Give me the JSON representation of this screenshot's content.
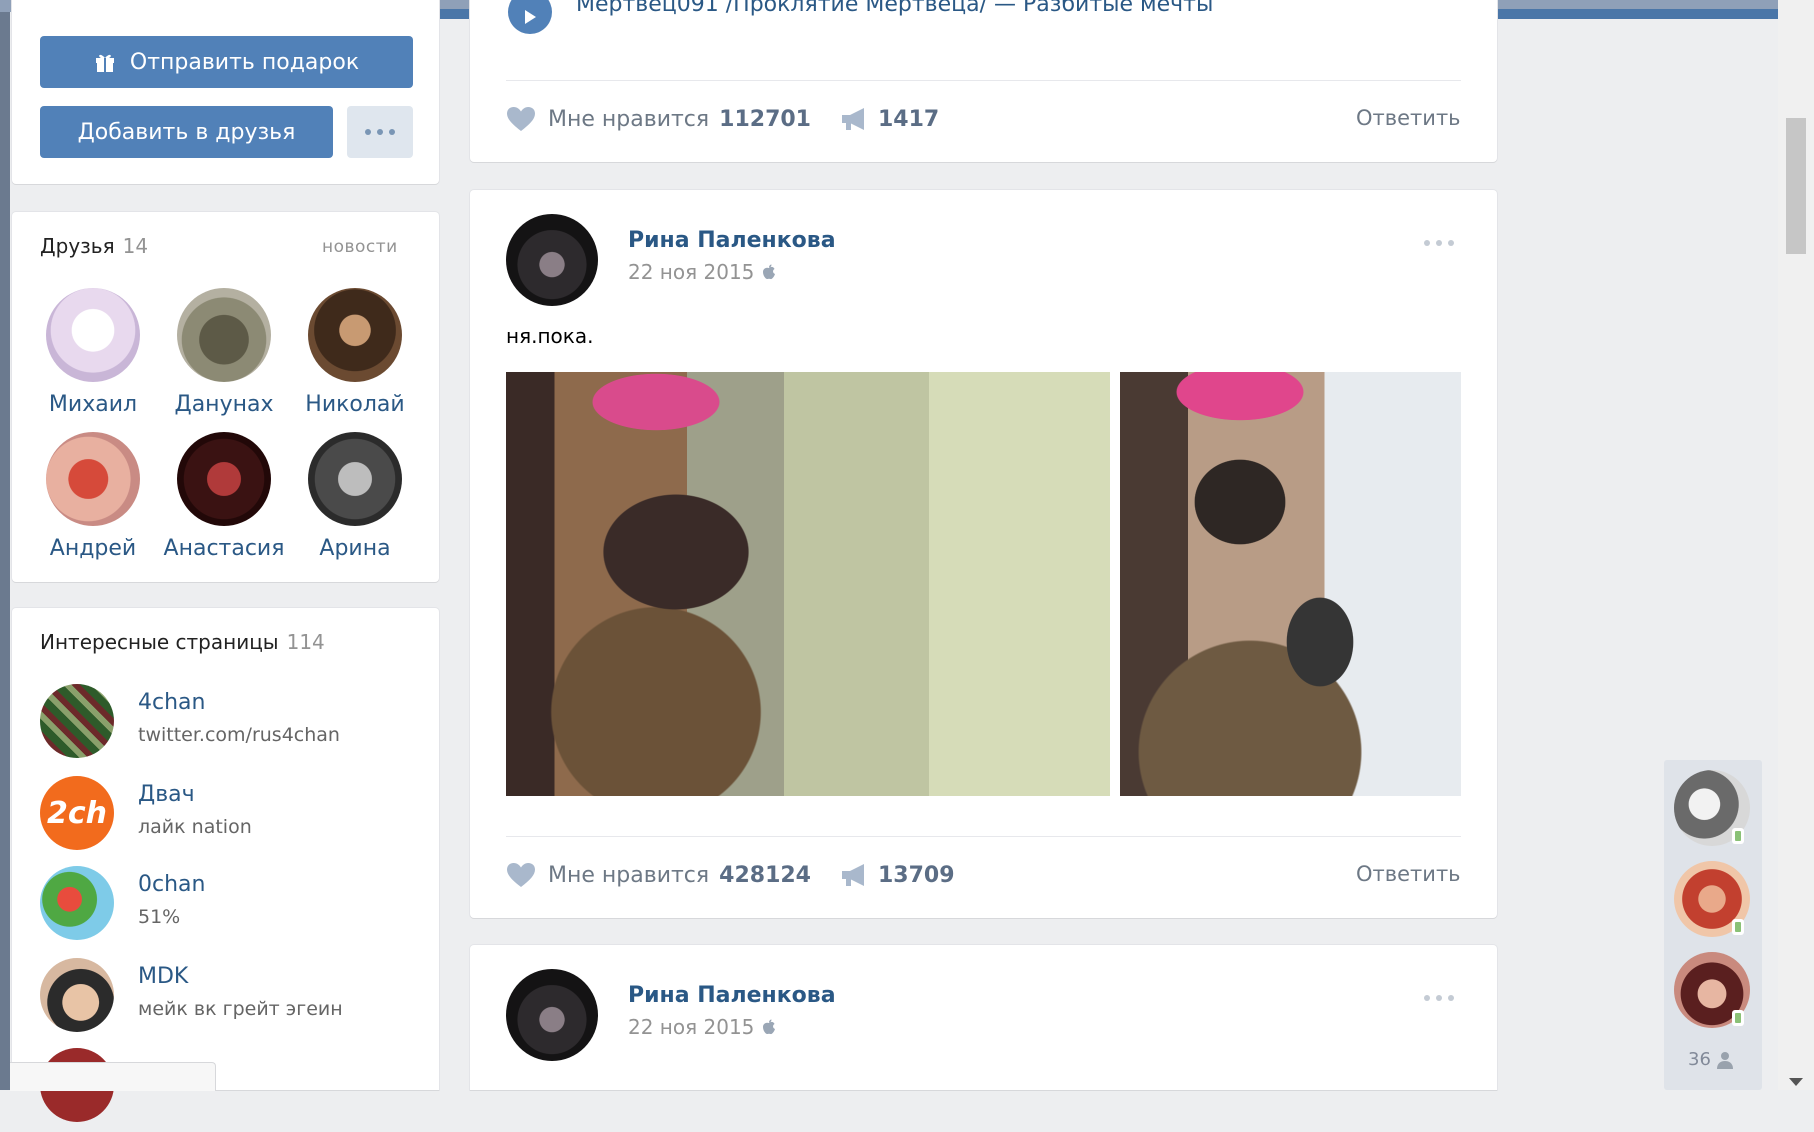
{
  "profile_actions": {
    "gift_label": "Отправить подарок",
    "add_friend_label": "Добавить в друзья"
  },
  "friends": {
    "title": "Друзья",
    "count": "14",
    "news_link": "новости",
    "items": [
      {
        "name": "Михаил"
      },
      {
        "name": "Данунах"
      },
      {
        "name": "Николай"
      },
      {
        "name": "Андрей"
      },
      {
        "name": "Анастасия"
      },
      {
        "name": "Арина"
      }
    ]
  },
  "pages": {
    "title": "Интересные страницы",
    "count": "114",
    "items": [
      {
        "name": "4chan",
        "sub": "twitter.com/rus4chan"
      },
      {
        "name": "Двач",
        "sub": "лайк nation",
        "avatar_text": "2ch"
      },
      {
        "name": "0chan",
        "sub": "51%"
      },
      {
        "name": "MDK",
        "sub": "мейк вк грейт эгеин"
      }
    ]
  },
  "posts": [
    {
      "top_text": "Мертвец091 /Проклятие Мертвеца/ — Разбитые мечты",
      "like_label": "Мне нравится",
      "likes": "112701",
      "reposts": "1417",
      "reply_label": "Ответить"
    },
    {
      "author": "Рина Паленкова",
      "date": "22 ноя 2015",
      "text": "ня.пока.",
      "like_label": "Мне нравится",
      "likes": "428124",
      "reposts": "13709",
      "reply_label": "Ответить"
    },
    {
      "author": "Рина Паленкова",
      "date": "22 ноя 2015"
    }
  ],
  "chat": {
    "online_count": "36"
  },
  "colors": {
    "accent": "#5181b8",
    "link": "#2a5885",
    "background": "#edeef0"
  },
  "icons": [
    "gift-icon",
    "more-icon",
    "heart-icon",
    "megaphone-icon",
    "apple-icon",
    "play-icon",
    "person-icon"
  ]
}
